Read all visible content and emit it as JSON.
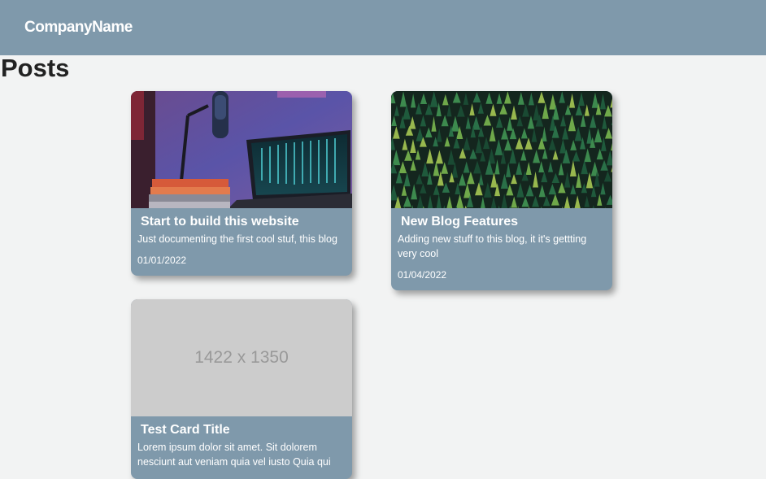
{
  "navbar": {
    "brand": "CompanyName",
    "color": "#7f99ab"
  },
  "page": {
    "title": "Posts"
  },
  "posts": [
    {
      "title": "Start to build this website",
      "excerpt": "Just documenting the first cool stuf, this blog",
      "date": "01/01/2022",
      "image": "photo-desk-microphone-laptop"
    },
    {
      "title": "New Blog Features",
      "excerpt": "Adding new stuff to this blog, it it's gettting very cool",
      "date": "01/04/2022",
      "image": "photo-pine-forest-aerial"
    },
    {
      "title": "Test Card Title",
      "excerpt": "Lorem ipsum dolor sit amet. Sit dolorem nesciunt aut veniam quia vel iusto Quia qui",
      "image_placeholder": "1422 x 1350"
    }
  ]
}
